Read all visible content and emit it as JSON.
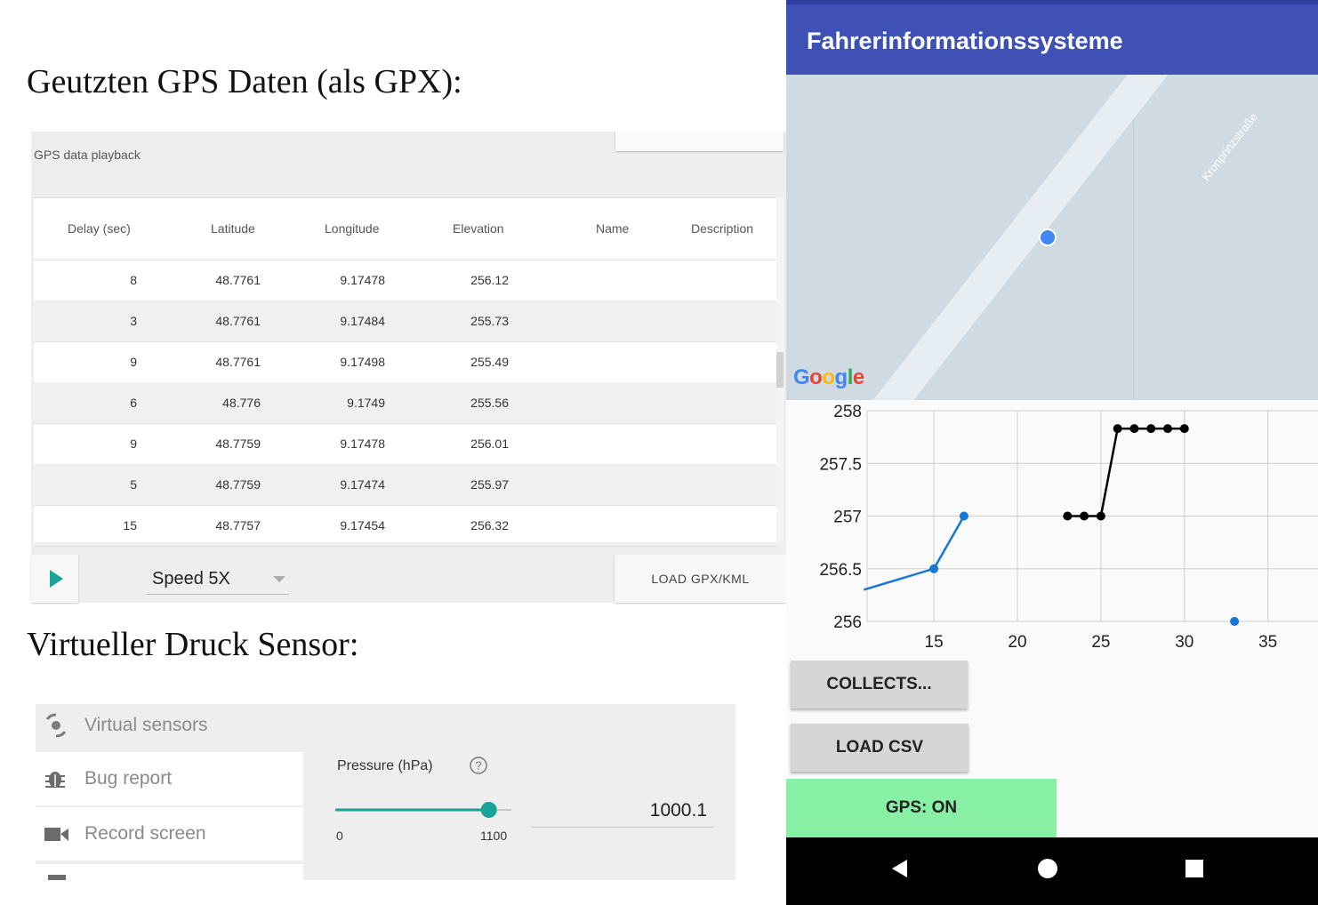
{
  "headings": {
    "gps": "Geutzten GPS Daten (als GPX):",
    "pressure": "Virtueller Druck Sensor:"
  },
  "gps_playback": {
    "caption": "GPS data playback",
    "columns": [
      "Delay (sec)",
      "Latitude",
      "Longitude",
      "Elevation",
      "Name",
      "Description"
    ],
    "rows": [
      {
        "delay": "8",
        "lat": "48.7761",
        "lon": "9.17478",
        "elev": "256.12",
        "name": "",
        "desc": ""
      },
      {
        "delay": "3",
        "lat": "48.7761",
        "lon": "9.17484",
        "elev": "255.73",
        "name": "",
        "desc": ""
      },
      {
        "delay": "9",
        "lat": "48.7761",
        "lon": "9.17498",
        "elev": "255.49",
        "name": "",
        "desc": ""
      },
      {
        "delay": "6",
        "lat": "48.776",
        "lon": "9.1749",
        "elev": "255.56",
        "name": "",
        "desc": ""
      },
      {
        "delay": "9",
        "lat": "48.7759",
        "lon": "9.17478",
        "elev": "256.01",
        "name": "",
        "desc": ""
      },
      {
        "delay": "5",
        "lat": "48.7759",
        "lon": "9.17474",
        "elev": "255.97",
        "name": "",
        "desc": ""
      },
      {
        "delay": "15",
        "lat": "48.7757",
        "lon": "9.17454",
        "elev": "256.32",
        "name": "",
        "desc": ""
      }
    ],
    "speed": "Speed 5X",
    "load_button": "LOAD GPX/KML",
    "play_icon": "play-icon"
  },
  "sensors": {
    "items": [
      {
        "label": "Virtual sensors",
        "icon": "virtual-sensors-icon"
      },
      {
        "label": "Bug report",
        "icon": "bug-icon"
      },
      {
        "label": "Record screen",
        "icon": "video-camera-icon"
      }
    ],
    "pressure": {
      "label": "Pressure (hPa)",
      "min": "0",
      "max": "1100",
      "value": "1000.1",
      "slider_fraction": 0.909,
      "help_icon": "help-icon"
    }
  },
  "android": {
    "app_title": "Fahrerinformationssysteme",
    "map": {
      "street": "Kronprinzstraße",
      "logo": "Google"
    },
    "buttons": {
      "collects": "COLLECTS...",
      "load_csv": "LOAD CSV",
      "gps_on": "GPS: ON"
    },
    "nav_icons": [
      "back-icon",
      "home-icon",
      "recents-icon"
    ],
    "colors": {
      "appbar": "#3f51b5",
      "gps_on": "#88f0a5",
      "blue_series": "#1976d2",
      "black_series": "#000000"
    }
  },
  "chart_data": {
    "type": "line",
    "xlim": [
      11,
      38
    ],
    "ylim": [
      256,
      258
    ],
    "x_ticks": [
      "15",
      "20",
      "25",
      "30",
      "35"
    ],
    "y_ticks": [
      "256",
      "256.5",
      "257",
      "257.5",
      "258"
    ],
    "grid": true,
    "series": [
      {
        "color": "#1976d2",
        "points": [
          [
            10.8,
            256.3
          ],
          [
            15,
            256.5
          ],
          [
            16.8,
            257
          ]
        ]
      },
      {
        "color": "#000000",
        "points": [
          [
            23,
            257
          ],
          [
            24,
            257
          ],
          [
            25,
            257
          ],
          [
            26,
            257.83
          ],
          [
            27,
            257.83
          ],
          [
            28,
            257.83
          ],
          [
            29,
            257.83
          ],
          [
            30,
            257.83
          ]
        ]
      },
      {
        "color": "#1976d2",
        "points": [
          [
            33,
            256
          ]
        ]
      }
    ]
  }
}
